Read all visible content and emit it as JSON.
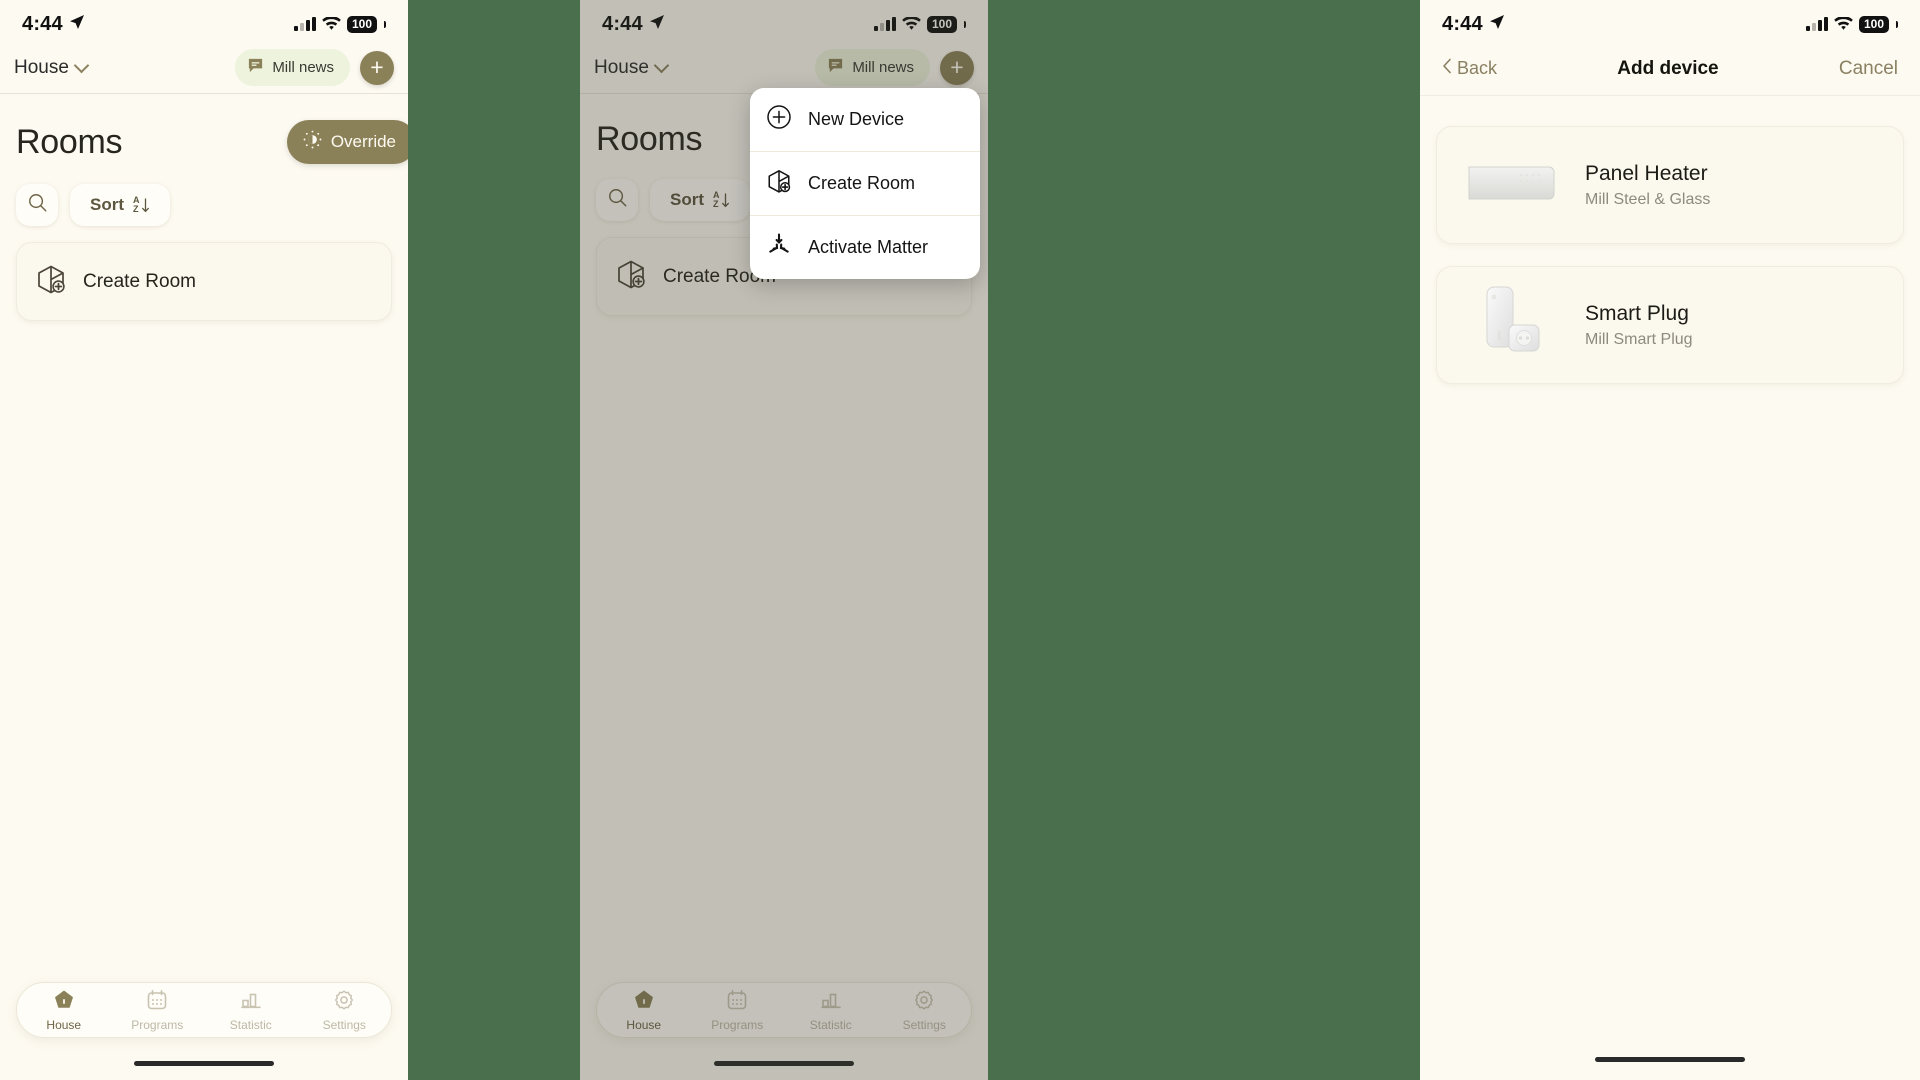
{
  "theme": {
    "background_green": "#4a6f4d",
    "app_bg": "#fdfaf1",
    "accent_brown": "#8b8158",
    "chip_green": "#edf3dc"
  },
  "status_bar": {
    "time": "4:44",
    "battery": "100",
    "location_icon": "location-arrow-icon",
    "signal_icon": "cellular-bars-icon",
    "wifi_icon": "wifi-icon"
  },
  "panel1": {
    "nav": {
      "house_label": "House",
      "news_chip": "Mill news",
      "add_button": "+"
    },
    "page_title": "Rooms",
    "override_button": "Override",
    "search_placeholder": "Search",
    "sort_button": "Sort",
    "create_room": "Create Room",
    "tabs": [
      {
        "label": "House",
        "icon": "house-icon",
        "active": true
      },
      {
        "label": "Programs",
        "icon": "calendar-icon",
        "active": false
      },
      {
        "label": "Statistic",
        "icon": "bar-chart-icon",
        "active": false
      },
      {
        "label": "Settings",
        "icon": "gear-icon",
        "active": false
      }
    ]
  },
  "panel2": {
    "nav": {
      "house_label": "House",
      "news_chip": "Mill news",
      "add_button": "+"
    },
    "page_title": "Rooms",
    "sort_button": "Sort",
    "create_room": "Create Room",
    "menu": [
      {
        "label": "New Device",
        "icon": "plus-circle-icon"
      },
      {
        "label": "Create Room",
        "icon": "room-add-icon"
      },
      {
        "label": "Activate Matter",
        "icon": "matter-icon"
      }
    ],
    "tabs": [
      {
        "label": "House",
        "icon": "house-icon",
        "active": true
      },
      {
        "label": "Programs",
        "icon": "calendar-icon",
        "active": false
      },
      {
        "label": "Statistic",
        "icon": "bar-chart-icon",
        "active": false
      },
      {
        "label": "Settings",
        "icon": "gear-icon",
        "active": false
      }
    ]
  },
  "panel3": {
    "back_label": "Back",
    "title": "Add device",
    "cancel_label": "Cancel",
    "devices": [
      {
        "name": "Panel Heater",
        "subtitle": "Mill Steel & Glass",
        "thumb": "panel-heater-image"
      },
      {
        "name": "Smart Plug",
        "subtitle": "Mill Smart Plug",
        "thumb": "smart-plug-image"
      }
    ]
  }
}
